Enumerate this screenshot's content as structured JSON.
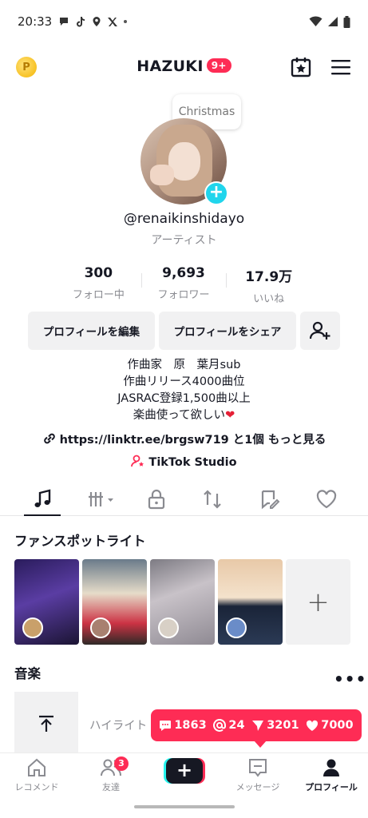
{
  "status_bar": {
    "time": "20:33"
  },
  "top_nav": {
    "username": "HAZUKI",
    "notifications": "9+"
  },
  "profile": {
    "bubble_text": "Christmas",
    "handle": "@renaikinshidayo",
    "category": "アーティスト",
    "stats": [
      {
        "value": "300",
        "label": "フォロー中"
      },
      {
        "value": "9,693",
        "label": "フォロワー"
      },
      {
        "value": "17.9万",
        "label": "いいね"
      }
    ],
    "buttons": {
      "edit": "プロフィールを編集",
      "share": "プロフィールをシェア"
    },
    "bio": [
      "作曲家　原　葉月sub",
      "作曲リリース4000曲位",
      "JASRAC登録1,500曲以上",
      "楽曲使って欲しい"
    ],
    "bio_heart": "❤",
    "link": "https://linktr.ee/brgsw719 と1個 もっと見る",
    "studio": "TikTok Studio"
  },
  "sections": {
    "spotlight_title": "ファンスポットライト",
    "music_title": "音楽",
    "more": "•••",
    "highlight": "ハイライト"
  },
  "activity": {
    "comments": "1863",
    "mentions": "24",
    "shares": "3201",
    "likes": "7000"
  },
  "bottom_nav": {
    "home": "レコメンド",
    "friends": "友達",
    "friends_badge": "3",
    "inbox": "メッセージ",
    "profile": "プロフィール"
  },
  "colors": {
    "accent": "#fe2c55",
    "cyan": "#20d5ec"
  }
}
